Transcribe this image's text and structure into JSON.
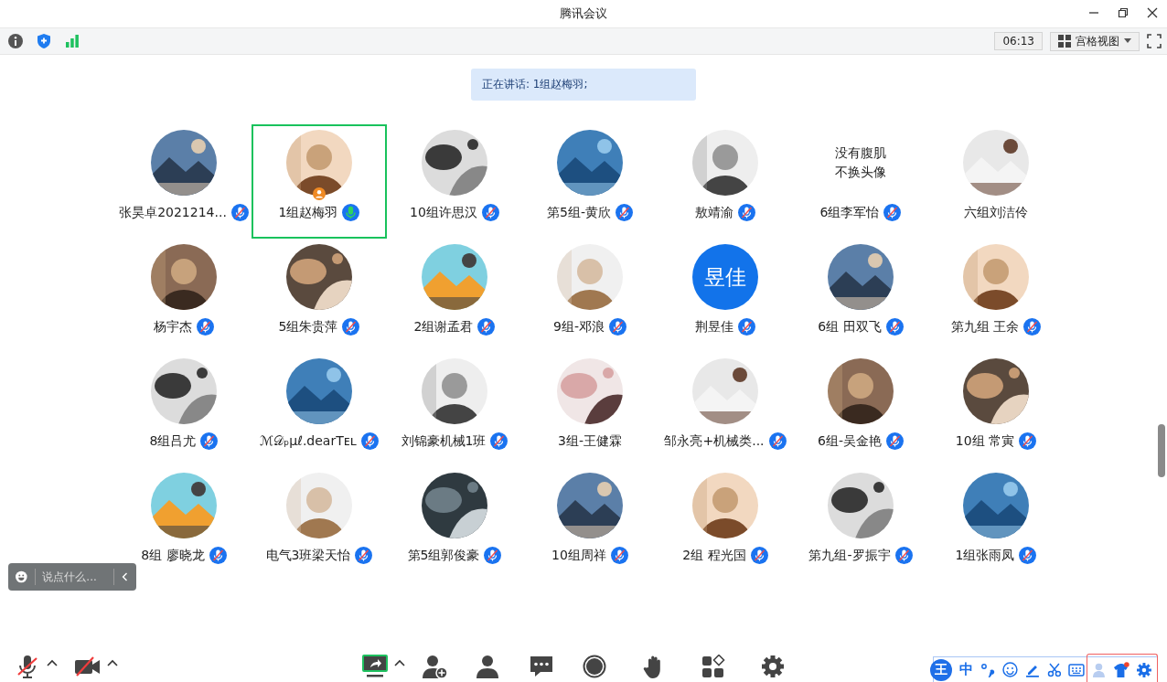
{
  "window": {
    "title": "腾讯会议"
  },
  "toolbar": {
    "time": "06:13",
    "view_button": "宫格视图"
  },
  "speaking_banner": "正在讲话: 1组赵梅羽;",
  "participants": [
    {
      "name": "张昊卓2021214...",
      "mic_icon": true,
      "muted": true,
      "host": false,
      "selected": false
    },
    {
      "name": "1组赵梅羽",
      "mic_icon": true,
      "muted": false,
      "host": true,
      "selected": true
    },
    {
      "name": "10组许思汉",
      "mic_icon": true,
      "muted": true,
      "host": false,
      "selected": false
    },
    {
      "name": "第5组-黄欣",
      "mic_icon": true,
      "muted": true,
      "host": false,
      "selected": false
    },
    {
      "name": "敖靖渝",
      "mic_icon": true,
      "muted": true,
      "host": false,
      "selected": false
    },
    {
      "name": "6组李军怡",
      "avatar": {
        "kind": "text",
        "lines": [
          "没有腹肌",
          "不换头像"
        ]
      },
      "mic_icon": true,
      "muted": true,
      "host": false,
      "selected": false
    },
    {
      "name": "六组刘洁伶",
      "mic_icon": false,
      "host": false,
      "selected": false
    },
    {
      "name": "杨宇杰",
      "mic_icon": true,
      "muted": true,
      "host": false,
      "selected": false
    },
    {
      "name": "5组朱贵萍",
      "mic_icon": true,
      "muted": true,
      "host": false,
      "selected": false
    },
    {
      "name": "2组谢孟君",
      "mic_icon": true,
      "muted": true,
      "host": false,
      "selected": false
    },
    {
      "name": "9组-邓浪",
      "mic_icon": true,
      "muted": true,
      "host": false,
      "selected": false
    },
    {
      "name": "荆昱佳",
      "avatar": {
        "kind": "initials",
        "text": "昱佳"
      },
      "mic_icon": true,
      "muted": true,
      "host": false,
      "selected": false
    },
    {
      "name": "6组 田双飞",
      "mic_icon": true,
      "muted": true,
      "host": false,
      "selected": false
    },
    {
      "name": "第九组 王余",
      "mic_icon": true,
      "muted": true,
      "host": false,
      "selected": false
    },
    {
      "name": "8组吕尤",
      "mic_icon": true,
      "muted": true,
      "host": false,
      "selected": false
    },
    {
      "name": "ℳ𝒟ₚμℓ.dearTᴇʟ",
      "mic_icon": true,
      "muted": true,
      "host": false,
      "selected": false
    },
    {
      "name": "刘锦豪机械1班",
      "mic_icon": true,
      "muted": true,
      "host": false,
      "selected": false
    },
    {
      "name": "3组-王健霖",
      "mic_icon": false,
      "host": false,
      "selected": false
    },
    {
      "name": "邹永亮+机械类...",
      "mic_icon": true,
      "muted": true,
      "host": false,
      "selected": false
    },
    {
      "name": "6组-吴金艳",
      "mic_icon": true,
      "muted": true,
      "host": false,
      "selected": false
    },
    {
      "name": "10组 常寅",
      "mic_icon": true,
      "muted": true,
      "host": false,
      "selected": false
    },
    {
      "name": "8组 廖晓龙",
      "mic_icon": true,
      "muted": true,
      "host": false,
      "selected": false
    },
    {
      "name": "电气3班梁天怡",
      "mic_icon": true,
      "muted": true,
      "host": false,
      "selected": false
    },
    {
      "name": "第5组郭俊豪",
      "mic_icon": true,
      "muted": true,
      "host": false,
      "selected": false
    },
    {
      "name": "10组周祥",
      "mic_icon": true,
      "muted": true,
      "host": false,
      "selected": false
    },
    {
      "name": "2组 程光国",
      "mic_icon": true,
      "muted": true,
      "host": false,
      "selected": false
    },
    {
      "name": "第九组-罗振宇",
      "mic_icon": true,
      "muted": true,
      "host": false,
      "selected": false
    },
    {
      "name": "1组张雨凤",
      "mic_icon": true,
      "muted": true,
      "host": false,
      "selected": false
    }
  ],
  "chat_box": {
    "placeholder": "说点什么..."
  },
  "input_method_bar": {
    "logo": "王",
    "mode": "中"
  }
}
